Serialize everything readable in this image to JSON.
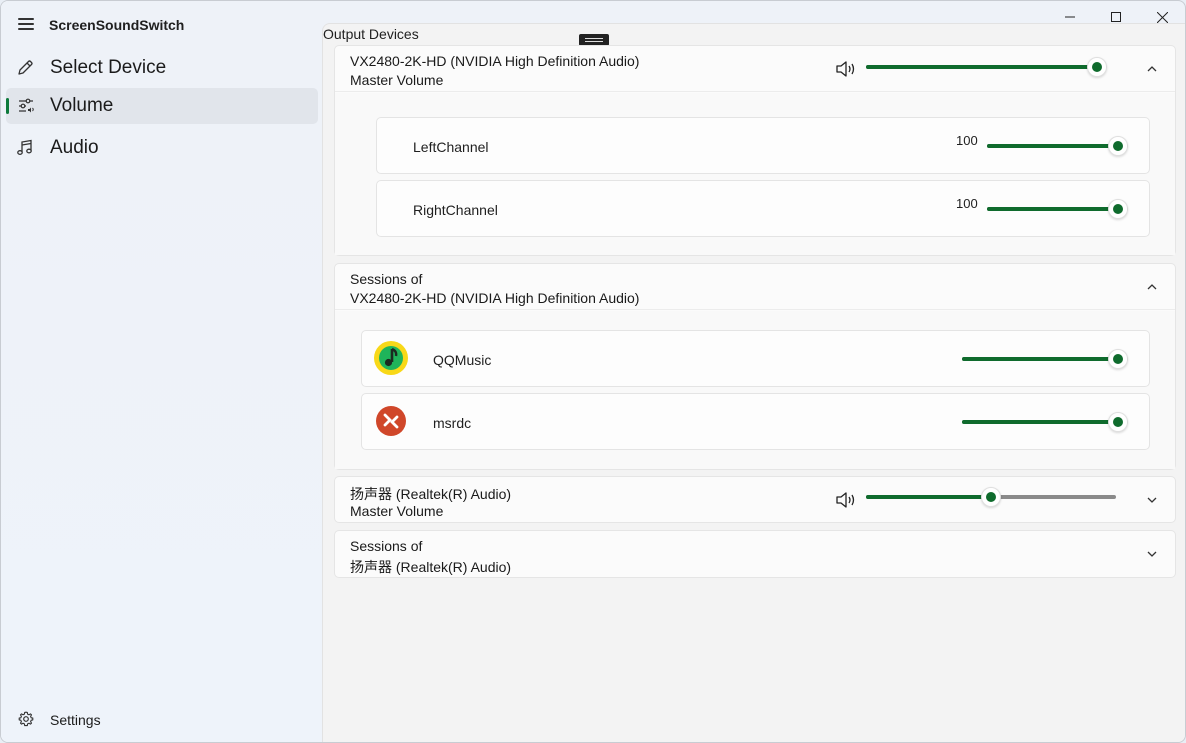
{
  "app": {
    "title": "ScreenSoundSwitch"
  },
  "sidebar": {
    "items": [
      {
        "label": "Select Device",
        "icon": "pencil-icon",
        "active": false
      },
      {
        "label": "Volume",
        "icon": "sliders-icon",
        "active": true
      },
      {
        "label": "Audio",
        "icon": "music-note-icon",
        "active": false
      }
    ],
    "settings_label": "Settings",
    "settings_icon": "gear-icon"
  },
  "main": {
    "section_title": "Output Devices",
    "devices": [
      {
        "name": "VX2480-2K-HD (NVIDIA High Definition Audio)",
        "subtitle": "Master Volume",
        "volume": 0.96,
        "expanded": true,
        "channels": [
          {
            "label": "LeftChannel",
            "value": "100",
            "level": 1.0
          },
          {
            "label": "RightChannel",
            "value": "100",
            "level": 1.0
          }
        ]
      },
      {
        "name": "扬声器 (Realtek(R) Audio)",
        "subtitle": "Master Volume",
        "volume": 0.5,
        "expanded": false
      }
    ],
    "sessions": [
      {
        "prefix": "Sessions of",
        "device": "VX2480-2K-HD (NVIDIA High Definition Audio)",
        "expanded": true,
        "apps": [
          {
            "name": "QQMusic",
            "icon": "qqmusic-icon",
            "level": 1.0
          },
          {
            "name": "msrdc",
            "icon": "remote-desktop-icon",
            "level": 1.0
          }
        ]
      },
      {
        "prefix": "Sessions of",
        "device": "扬声器 (Realtek(R) Audio)",
        "expanded": false
      }
    ]
  },
  "colors": {
    "accent": "#0f6b2d",
    "track": "#8a8a8a",
    "qqmusic_yellow": "#f8d818",
    "msrdc_red": "#d0472a"
  }
}
